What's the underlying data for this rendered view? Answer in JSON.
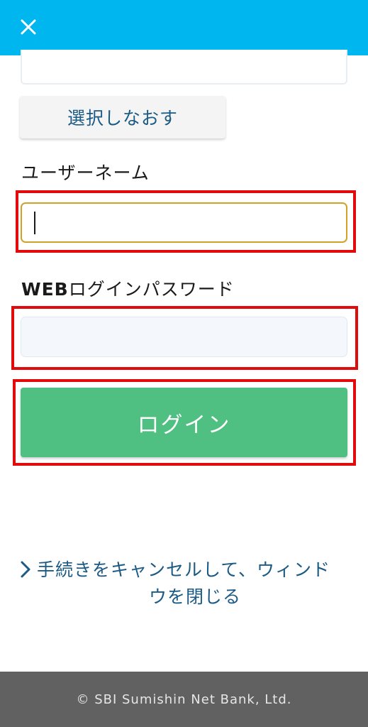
{
  "header": {
    "close_icon": "close-icon",
    "color": "#00b6ee"
  },
  "form": {
    "reselect_label": "選択しなおす",
    "username_label": "ユーザーネーム",
    "password_label_bold": "WEB",
    "password_label_rest": "ログインパスワード",
    "username_value": "",
    "password_value": "",
    "login_label": "ログイン",
    "login_color": "#4fc081",
    "highlight_color": "#e10b0b"
  },
  "cancel": {
    "line1": "手続きをキャンセルして、ウィンド",
    "line2": "ウを閉じる",
    "icon": "chevron-right-icon"
  },
  "footer": {
    "copyright": "© SBI Sumishin Net Bank, Ltd."
  }
}
